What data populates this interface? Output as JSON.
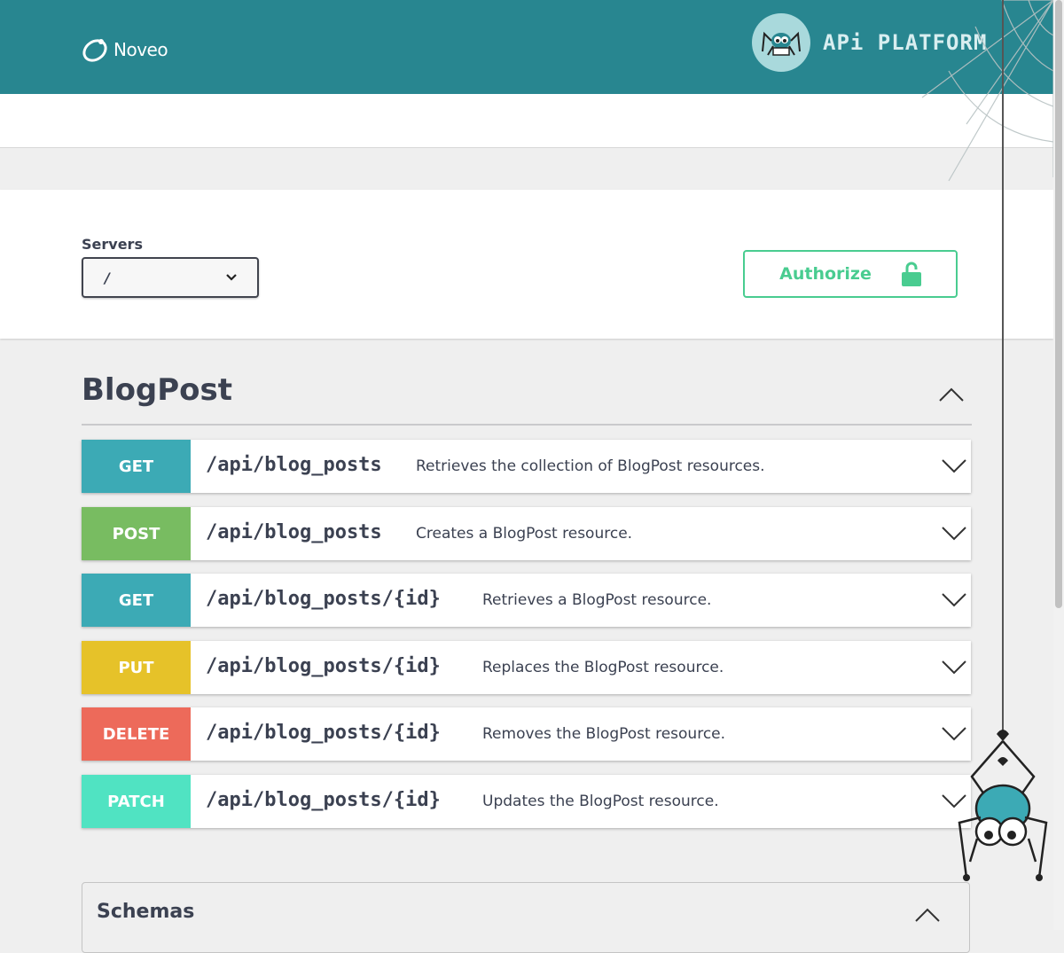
{
  "header": {
    "logo_text": "Noveo",
    "platform_text": "APi PLATFORM"
  },
  "servers": {
    "label": "Servers",
    "selected": "/"
  },
  "authorize": {
    "label": "Authorize"
  },
  "tag": {
    "title": "BlogPost"
  },
  "operations": [
    {
      "method": "GET",
      "path": "/api/blog_posts",
      "summary": "Retrieves the collection of BlogPost resources.",
      "color": "#3caab5"
    },
    {
      "method": "POST",
      "path": "/api/blog_posts",
      "summary": "Creates a BlogPost resource.",
      "color": "#78bc61"
    },
    {
      "method": "GET",
      "path": "/api/blog_posts/{id}",
      "summary": "Retrieves a BlogPost resource.",
      "color": "#3caab5"
    },
    {
      "method": "PUT",
      "path": "/api/blog_posts/{id}",
      "summary": "Replaces the BlogPost resource.",
      "color": "#e6c229"
    },
    {
      "method": "DELETE",
      "path": "/api/blog_posts/{id}",
      "summary": "Removes the BlogPost resource.",
      "color": "#ed6a5a"
    },
    {
      "method": "PATCH",
      "path": "/api/blog_posts/{id}",
      "summary": "Updates the BlogPost resource.",
      "color": "#50e3c2"
    }
  ],
  "schemas": {
    "title": "Schemas"
  },
  "colors": {
    "header_bg": "#288690",
    "authorize": "#49cc90"
  }
}
